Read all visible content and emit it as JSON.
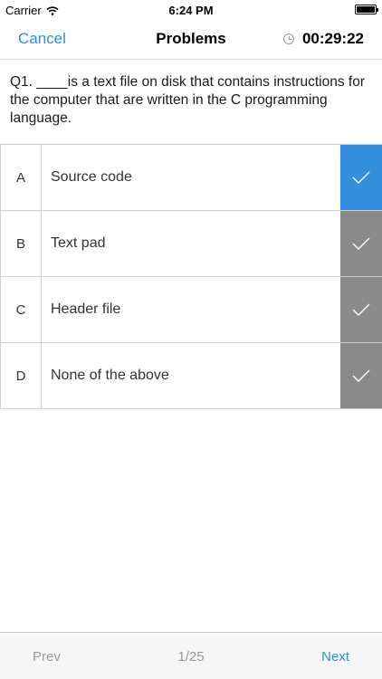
{
  "status": {
    "carrier": "Carrier",
    "time": "6:24 PM"
  },
  "nav": {
    "cancel": "Cancel",
    "title": "Problems",
    "timer": "00:29:22"
  },
  "question": {
    "text": "Q1. ____is a text file on disk that contains instructions for the computer that are written in the C programming language."
  },
  "options": [
    {
      "letter": "A",
      "text": "Source code",
      "selected": true
    },
    {
      "letter": "B",
      "text": "Text pad",
      "selected": false
    },
    {
      "letter": "C",
      "text": "Header file",
      "selected": false
    },
    {
      "letter": "D",
      "text": "None of the above",
      "selected": false
    }
  ],
  "footer": {
    "prev": "Prev",
    "page": "1/25",
    "next": "Next"
  },
  "colors": {
    "accent": "#2c8fd9",
    "selected": "#3490dc",
    "unselected": "#8a8a8a"
  }
}
